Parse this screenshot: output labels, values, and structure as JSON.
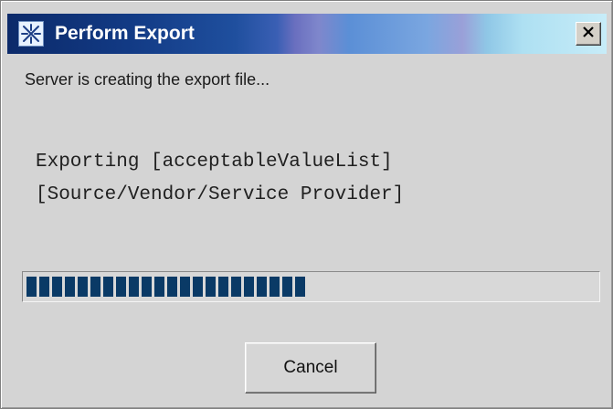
{
  "window": {
    "title": "Perform Export",
    "icon": "export-app-icon",
    "close_icon": "close-icon"
  },
  "status": {
    "message": "Server is creating the export file..."
  },
  "export": {
    "line1": "Exporting [acceptableValueList]",
    "line2": "[Source/Vendor/Service Provider]"
  },
  "progress": {
    "fraction": 0.505
  },
  "buttons": {
    "cancel_label": "Cancel"
  },
  "colors": {
    "progress_fill": "#0a3a66",
    "title_bar_start": "#0c2a6a",
    "dialog_background": "#d4d4d4"
  }
}
